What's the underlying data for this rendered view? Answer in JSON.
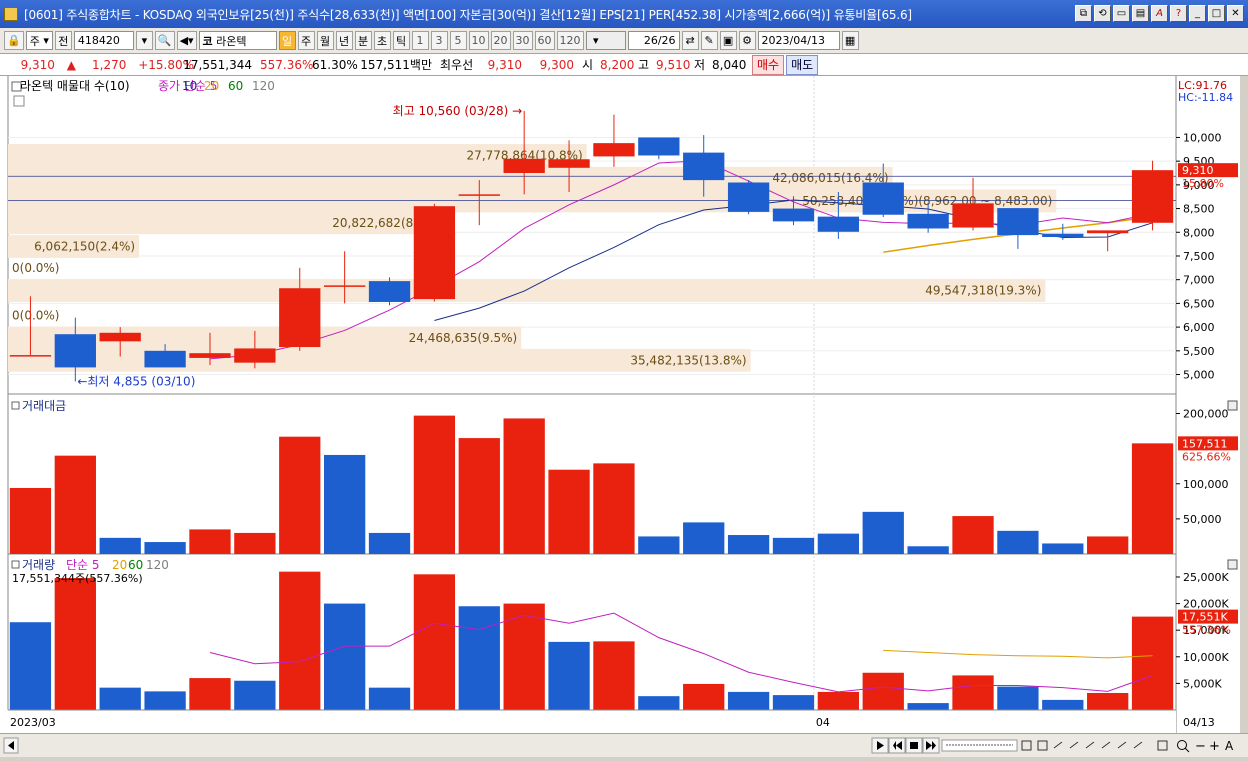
{
  "window": {
    "title": "[0601] 주식종합차트 - KOSDAQ 외국인보유[25(천)] 주식수[28,633(천)] 액면[100] 자본금[30(억)] 결산[12월] EPS[21] PER[452.38] 시가총액[2,666(억)] 유통비율[65.6]"
  },
  "toolbar": {
    "market": "주",
    "prev_label": "전",
    "code": "418420",
    "stock_name": "라온텍",
    "stock_prefix": "코",
    "periods": [
      "일",
      "주",
      "월",
      "년",
      "분",
      "초",
      "틱"
    ],
    "active_period": "일",
    "minutes": [
      "1",
      "3",
      "5",
      "10",
      "20",
      "30",
      "60",
      "120"
    ],
    "count": "26",
    "count_total": "/26",
    "date": "2023/04/13"
  },
  "quote": {
    "price": "9,310",
    "arrow": "▲",
    "change": "1,270",
    "change_pct": "+15.80%",
    "volume": "17,551,344",
    "vol_ratio": "557.36%",
    "turnover": "61.30%",
    "amount": "157,511백만",
    "best_label": "최우선",
    "ask": "9,310",
    "bid": "9,300",
    "open_label": "시",
    "open": "8,200",
    "high_label": "고",
    "high": "9,510",
    "low_label": "저",
    "low": "8,040",
    "buy_label": "매수",
    "sell_label": "매도"
  },
  "chart_data": [
    {
      "type": "candlestick",
      "panel": "price",
      "legend": [
        "라온텍 매물대 수(10)",
        "종가 단순 5",
        "10",
        "20",
        "60",
        "120"
      ],
      "legend_colors": [
        "#000000",
        "#c020c0",
        "#1a2f8a",
        "#e0a000",
        "#008000",
        "#808080"
      ],
      "x_labels": [
        "2023/03",
        "04",
        "04/13"
      ],
      "candles": [
        {
          "o": 5410,
          "h": 6650,
          "l": 5410,
          "c": 5410
        },
        {
          "o": 5850,
          "h": 6200,
          "l": 4855,
          "c": 5150
        },
        {
          "o": 5700,
          "h": 6000,
          "l": 5380,
          "c": 5880
        },
        {
          "o": 5500,
          "h": 5640,
          "l": 5250,
          "c": 5150
        },
        {
          "o": 5350,
          "h": 5880,
          "l": 5200,
          "c": 5450
        },
        {
          "o": 5250,
          "h": 5920,
          "l": 5130,
          "c": 5550
        },
        {
          "o": 5580,
          "h": 7250,
          "l": 5500,
          "c": 6820
        },
        {
          "o": 6880,
          "h": 7600,
          "l": 6500,
          "c": 6880
        },
        {
          "o": 6970,
          "h": 7050,
          "l": 6460,
          "c": 6530
        },
        {
          "o": 6590,
          "h": 8600,
          "l": 6540,
          "c": 8550
        },
        {
          "o": 8800,
          "h": 9100,
          "l": 8150,
          "c": 8800
        },
        {
          "o": 9250,
          "h": 10560,
          "l": 8800,
          "c": 9550
        },
        {
          "o": 9360,
          "h": 9940,
          "l": 8850,
          "c": 9540
        },
        {
          "o": 9600,
          "h": 10480,
          "l": 9380,
          "c": 9880
        },
        {
          "o": 10000,
          "h": 10000,
          "l": 9540,
          "c": 9620
        },
        {
          "o": 9680,
          "h": 10050,
          "l": 8750,
          "c": 9100
        },
        {
          "o": 9050,
          "h": 9100,
          "l": 8380,
          "c": 8430
        },
        {
          "o": 8500,
          "h": 8760,
          "l": 8150,
          "c": 8230
        },
        {
          "o": 8330,
          "h": 8850,
          "l": 7860,
          "c": 8010
        },
        {
          "o": 9050,
          "h": 9450,
          "l": 8320,
          "c": 8370
        },
        {
          "o": 8390,
          "h": 8620,
          "l": 7990,
          "c": 8080
        },
        {
          "o": 8100,
          "h": 9150,
          "l": 8040,
          "c": 8610
        },
        {
          "o": 8510,
          "h": 8510,
          "l": 7650,
          "c": 7940
        },
        {
          "o": 7970,
          "h": 8180,
          "l": 7840,
          "c": 7900
        },
        {
          "o": 7980,
          "h": 8040,
          "l": 7600,
          "c": 8040
        },
        {
          "o": 8200,
          "h": 9510,
          "l": 8040,
          "c": 9310
        }
      ],
      "ma5": [
        null,
        null,
        null,
        null,
        5330,
        5420,
        5630,
        5930,
        6360,
        6850,
        7380,
        8080,
        8580,
        9000,
        9460,
        9510,
        9080,
        8640,
        8300,
        8210,
        8180,
        8200,
        8150,
        8300,
        8200,
        8400
      ],
      "ma10": [
        null,
        null,
        null,
        null,
        null,
        null,
        null,
        null,
        null,
        6140,
        6400,
        6760,
        7250,
        7680,
        8160,
        8470,
        8570,
        8680,
        8620,
        8560,
        8490,
        8280,
        8050,
        7890,
        7900,
        8200
      ],
      "ma20": [
        null,
        null,
        null,
        null,
        null,
        null,
        null,
        null,
        null,
        null,
        null,
        null,
        null,
        null,
        null,
        null,
        null,
        null,
        null,
        7580,
        7720,
        7850,
        7970,
        8090,
        8200,
        8330
      ],
      "volume_profile": [
        {
          "label": "0(0.0%)",
          "price": 7250,
          "width": 0.0
        },
        {
          "label": "0(0.0%)",
          "price": 6250,
          "width": 0.0
        },
        {
          "label": "6,062,150(2.4%)",
          "price": 7700,
          "width": 0.12
        },
        {
          "label": "24,468,635(9.5%)",
          "price": 5770,
          "width": 0.47
        },
        {
          "label": "35,482,135(13.8%)",
          "price": 5300,
          "width": 0.68
        },
        {
          "label": "49,547,318(19.3%)",
          "price": 6770,
          "width": 0.95
        },
        {
          "label": "20,822,682(8.1%)",
          "price": 8200,
          "width": 0.4
        },
        {
          "label": "50,258,404(19.6%)(8,962.00 ~ 8,483.00)",
          "price": 8660,
          "width": 0.96
        },
        {
          "label": "42,086,015(16.4%)",
          "price": 9140,
          "width": 0.81
        },
        {
          "label": "27,778,864(10.8%)",
          "price": 9620,
          "width": 0.53
        }
      ],
      "high_label": "최고 10,560 (03/28) →",
      "low_label": "←최저 4,855 (03/10)",
      "y_ticks": [
        5000,
        5500,
        6000,
        6500,
        7000,
        7500,
        8000,
        8500,
        9000,
        9500,
        10000
      ],
      "y_tick_labels": [
        "5,000",
        "5,500",
        "6,000",
        "6,500",
        "7,000",
        "7,500",
        "8,000",
        "8,500",
        "9,000",
        "9,500",
        "10,000"
      ],
      "lc_label": "LC:91.76",
      "hc_label": "HC:-11.84",
      "price_tag": "9,310",
      "pct_tag": "15.80%"
    },
    {
      "type": "bar",
      "panel": "amount",
      "title": "거래대금",
      "values": [
        94000,
        140000,
        23000,
        17000,
        35000,
        30000,
        167000,
        141000,
        30000,
        197000,
        165000,
        193000,
        120000,
        129000,
        25000,
        45000,
        27000,
        23000,
        29000,
        60000,
        11000,
        54000,
        33000,
        15000,
        25000,
        157511
      ],
      "up": [
        true,
        true,
        false,
        false,
        true,
        true,
        true,
        false,
        false,
        true,
        true,
        true,
        true,
        true,
        false,
        false,
        false,
        false,
        false,
        false,
        false,
        true,
        false,
        false,
        true,
        true
      ],
      "y_ticks": [
        50000,
        100000,
        200000
      ],
      "y_tick_labels": [
        "50,000",
        "100,000",
        "200,000"
      ],
      "tag": "157,511",
      "tag2": "625.66%"
    },
    {
      "type": "bar",
      "panel": "volume",
      "title": "거래량",
      "legend": [
        "단순 5",
        "20",
        "60",
        "120"
      ],
      "legend_colors": [
        "#c020c0",
        "#e0a000",
        "#008000",
        "#808080"
      ],
      "sub_label": "17,551,344주(557.36%)",
      "values": [
        16500,
        24800,
        4200,
        3500,
        6000,
        5500,
        26000,
        20000,
        4200,
        25500,
        19500,
        20000,
        12800,
        12900,
        2600,
        4900,
        3400,
        2800,
        3400,
        7000,
        1300,
        6500,
        4400,
        1900,
        3200,
        17551
      ],
      "up": [
        false,
        true,
        false,
        false,
        true,
        false,
        true,
        false,
        false,
        true,
        false,
        true,
        false,
        true,
        false,
        true,
        false,
        false,
        true,
        true,
        false,
        true,
        false,
        false,
        true,
        true
      ],
      "ma5": [
        null,
        null,
        null,
        null,
        10800,
        8700,
        9100,
        12000,
        12000,
        16300,
        15100,
        17800,
        16300,
        18200,
        13600,
        10600,
        7100,
        5200,
        3400,
        4300,
        3600,
        4600,
        4600,
        4200,
        3500,
        6500
      ],
      "ma20": [
        null,
        null,
        null,
        null,
        null,
        null,
        null,
        null,
        null,
        null,
        null,
        null,
        null,
        null,
        null,
        null,
        null,
        null,
        null,
        11200,
        10800,
        10400,
        10200,
        10100,
        9800,
        10200
      ],
      "y_ticks": [
        5000,
        10000,
        15000,
        20000,
        25000
      ],
      "y_tick_labels": [
        "5,000K",
        "10,000K",
        "15,000K",
        "20,000K",
        "25,000K"
      ],
      "tag": "17,551K",
      "tag2": "557.36%"
    }
  ],
  "colors": {
    "up": "#e8220e",
    "down": "#1e5fd0",
    "profile": "#f7e8d8",
    "profile_text": "#6b4f14",
    "ma5": "#c020c0",
    "ma10": "#1a2f8a",
    "ma20": "#e0a000"
  }
}
